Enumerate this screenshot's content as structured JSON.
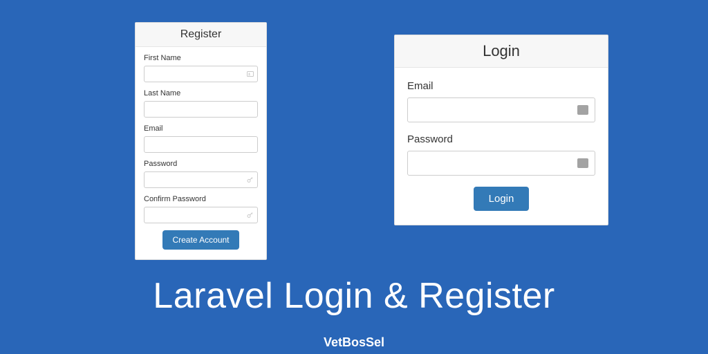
{
  "register": {
    "title": "Register",
    "fields": {
      "first_name": {
        "label": "First Name"
      },
      "last_name": {
        "label": "Last Name"
      },
      "email": {
        "label": "Email"
      },
      "password": {
        "label": "Password"
      },
      "confirm_password": {
        "label": "Confirm Password"
      }
    },
    "submit_label": "Create Account"
  },
  "login": {
    "title": "Login",
    "fields": {
      "email": {
        "label": "Email"
      },
      "password": {
        "label": "Password"
      }
    },
    "submit_label": "Login"
  },
  "headline": "Laravel Login & Register",
  "brand": "VetBosSel"
}
